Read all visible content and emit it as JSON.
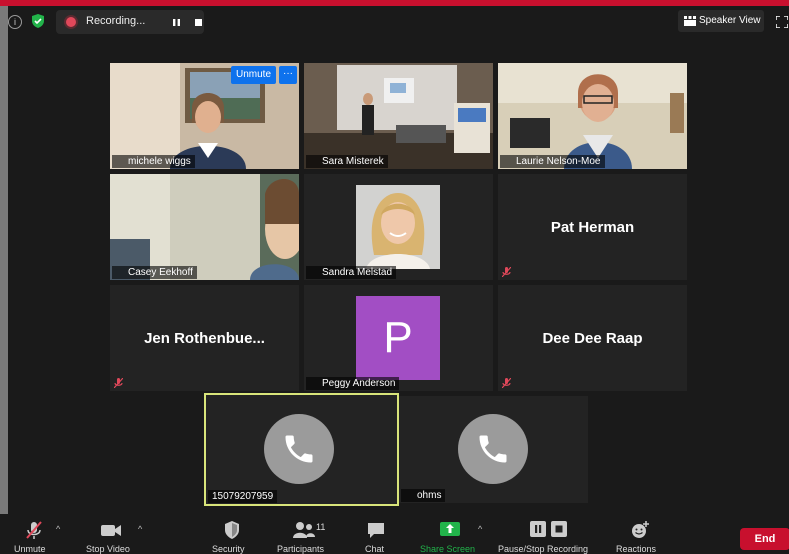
{
  "top_bar": {
    "recording_label": "Recording...",
    "speaker_view_label": "Speaker View"
  },
  "participants": [
    {
      "name": "michele wiggs"
    },
    {
      "name": "Sara Misterek"
    },
    {
      "name": "Laurie Nelson-Moe"
    },
    {
      "name": "Casey Eekhoff"
    },
    {
      "name": "Sandra Melstad"
    },
    {
      "name": "Pat Herman"
    },
    {
      "name": "Jen  Rothenbue..."
    },
    {
      "name": "Peggy Anderson",
      "avatar_letter": "P",
      "avatar_color": "#a24ec4"
    },
    {
      "name": "Dee Dee Raap"
    },
    {
      "name": "15079207959"
    },
    {
      "name": "ohms"
    }
  ],
  "tile_controls": {
    "unmute_label": "Unmute",
    "more_label": "···"
  },
  "toolbar": {
    "unmute_label": "Unmute",
    "stop_video_label": "Stop Video",
    "security_label": "Security",
    "participants_label": "Participants",
    "participants_count": "11",
    "chat_label": "Chat",
    "share_screen_label": "Share Screen",
    "pause_stop_recording_label": "Pause/Stop Recording",
    "reactions_label": "Reactions",
    "end_label": "End"
  },
  "colors": {
    "brand_red": "#c8102e",
    "active_speaker_border": "#d8e47a",
    "share_green": "#22b34a",
    "unmute_blue": "#0e72ed"
  }
}
